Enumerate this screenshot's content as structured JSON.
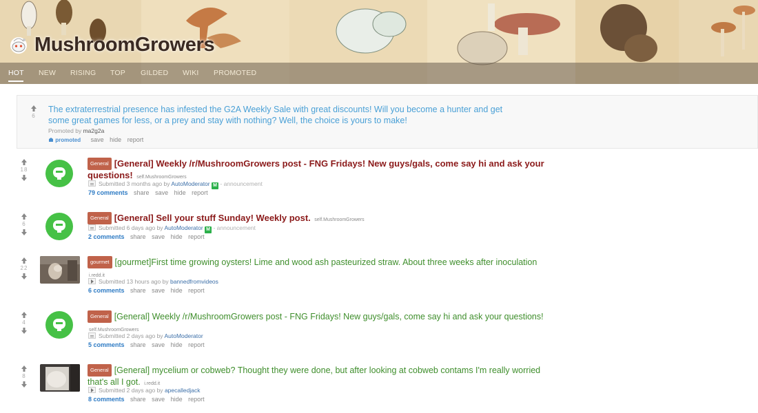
{
  "subreddit": {
    "name": "MushroomGrowers"
  },
  "tabs": [
    "HOT",
    "NEW",
    "RISING",
    "TOP",
    "GILDED",
    "WIKI",
    "PROMOTED"
  ],
  "active_tab": "HOT",
  "promoted": {
    "score": "6",
    "title_line1": "The extraterrestrial presence has infested the G2A Weekly Sale with great discounts! Will you become a hunter and get",
    "title_line2": "some great games for less, or a prey and stay with nothing? Well, the choice is yours to make!",
    "promoted_by_label": "Promoted by",
    "promoted_by": "ma2g2a",
    "promoted_label": "promoted",
    "buttons": [
      "save",
      "hide",
      "report"
    ]
  },
  "posts": [
    {
      "score": "18",
      "flair": "General",
      "title_line1": "[General] Weekly /r/MushroomGrowers post - FNG Fridays! New guys/gals, come say hi and ask your",
      "title_line2": "questions!",
      "domain": "self.MushroomGrowers",
      "submitted": "Submitted 3 months ago by",
      "author": "AutoModerator",
      "badge": "M",
      "suffix": "- announcement",
      "comments": "79 comments",
      "buttons": [
        "share",
        "save",
        "hide",
        "report"
      ]
    },
    {
      "score": "6",
      "flair": "General",
      "title_line1": "[General] Sell your stuff Sunday! Weekly post.",
      "domain": "self.MushroomGrowers",
      "submitted": "Submitted 6 days ago by",
      "author": "AutoModerator",
      "badge": "M",
      "suffix": "- announcement",
      "comments": "2 comments",
      "buttons": [
        "share",
        "save",
        "hide",
        "report"
      ]
    },
    {
      "score": "22",
      "flair": "gourmet",
      "title_line1": "[gourmet]First time growing oysters! Lime and wood ash pasteurized straw. About three weeks after inoculation",
      "domain": "i.redd.it",
      "submitted": "Submitted 13 hours ago by",
      "author": "bannedfromvideos",
      "comments": "6 comments",
      "buttons": [
        "share",
        "save",
        "hide",
        "report"
      ]
    },
    {
      "score": "4",
      "flair": "General",
      "title_line1": "[General] Weekly /r/MushroomGrowers post - FNG Fridays! New guys/gals, come say hi and ask your questions!",
      "domain": "self.MushroomGrowers",
      "submitted": "Submitted 2 days ago by",
      "author": "AutoModerator",
      "comments": "5 comments",
      "buttons": [
        "share",
        "save",
        "hide",
        "report"
      ]
    },
    {
      "score": "8",
      "flair": "General",
      "title_line1": "[General] mycelium or cobweb? Thought they were done, but after looking at cobweb contams I'm really worried",
      "title_line2": "that's all I got.",
      "domain": "i.redd.it",
      "submitted": "Submitted 2 days ago by",
      "author": "apecalledjack",
      "comments": "8 comments",
      "buttons": [
        "share",
        "save",
        "hide",
        "report"
      ]
    }
  ],
  "colors": {
    "link_blue": "#4aa0d6",
    "title_dark_red": "#8b1a1a",
    "title_green": "#3f8e2c",
    "flair_bg": "#c0624a",
    "reddit_green_icon": "#46c146"
  }
}
